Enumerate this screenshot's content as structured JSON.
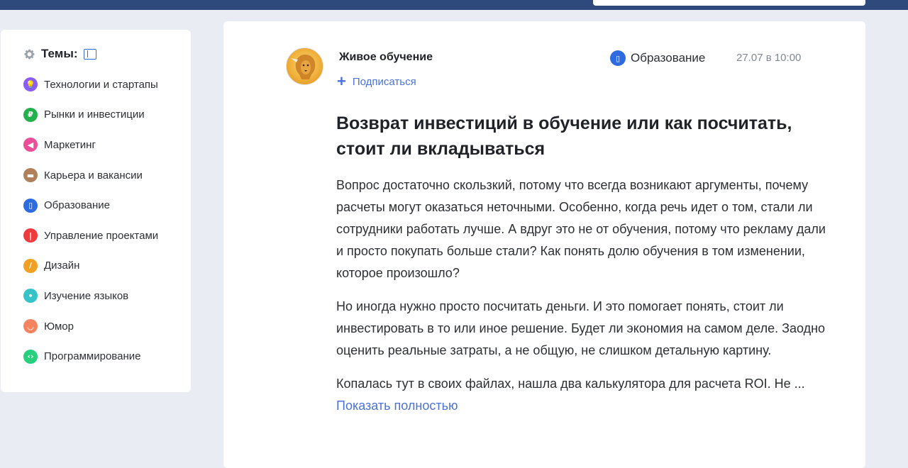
{
  "sidebar": {
    "title": "Темы:",
    "items": [
      {
        "label": "Технологии и стартапы",
        "icon": "lightbulb-icon",
        "color": "#8b5cf6",
        "glyph": "💡"
      },
      {
        "label": "Рынки и инвестиции",
        "icon": "ruble-icon",
        "color": "#22b14c",
        "glyph": "₽"
      },
      {
        "label": "Маркетинг",
        "icon": "megaphone-icon",
        "color": "#ec4f9a",
        "glyph": "◀"
      },
      {
        "label": "Карьера и вакансии",
        "icon": "briefcase-icon",
        "color": "#b0805a",
        "glyph": "▬"
      },
      {
        "label": "Образование",
        "icon": "book-icon",
        "color": "#2f6be0",
        "glyph": "▯"
      },
      {
        "label": "Управление проектами",
        "icon": "thermometer-icon",
        "color": "#ef3b3b",
        "glyph": "|"
      },
      {
        "label": "Дизайн",
        "icon": "pencil-icon",
        "color": "#f2a024",
        "glyph": "/"
      },
      {
        "label": "Изучение языков",
        "icon": "chat-icon",
        "color": "#35c2c9",
        "glyph": "•"
      },
      {
        "label": "Юмор",
        "icon": "smile-icon",
        "color": "#f4845f",
        "glyph": "◡"
      },
      {
        "label": "Программирование",
        "icon": "code-icon",
        "color": "#26d07c",
        "glyph": "‹›"
      }
    ]
  },
  "post": {
    "author": "Живое обучение",
    "subscribe_label": "Подписаться",
    "category": "Образование",
    "category_color": "#2f6be0",
    "date": "27.07 в 10:00",
    "title": "Возврат инвестиций в обучение или как посчитать, стоит ли вкладываться",
    "paragraphs": [
      "Вопрос достаточно скользкий, потому что всегда возникают аргументы, почему расчеты могут оказаться неточными. Особенно, когда речь идет о том, стали ли сотрудники работать лучше. А вдруг это не от обучения, потому что рекламу дали и просто покупать больше стали? Как понять долю обучения в том изменении, которое произошло?",
      "Но иногда нужно просто посчитать деньги. И это помогает понять, стоит ли инвестировать в то или иное решение. Будет ли экономия на самом деле. Заодно оценить реальные затраты, а не общую, не слишком детальную картину."
    ],
    "last_paragraph": "Копалась тут в своих файлах, нашла два калькулятора для расчета ROI. Не ...",
    "show_more_label": "Показать полностью"
  }
}
